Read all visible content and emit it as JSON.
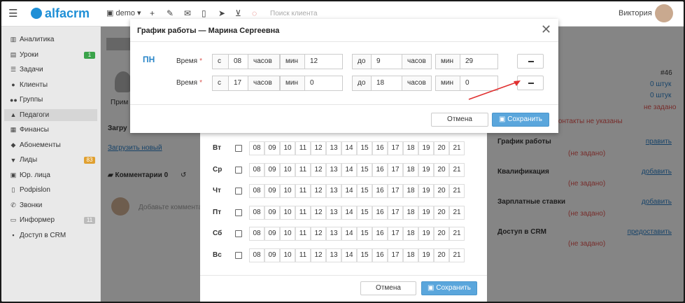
{
  "colors": {
    "brand": "#1e8fd6",
    "accent": "#5aa6dc",
    "danger": "#d9534f",
    "link": "#2a7bbf"
  },
  "topbar": {
    "logo": "alfacrm",
    "branch": "demo",
    "search_placeholder": "Поиск клиента",
    "user": "Виктория"
  },
  "sidebar": {
    "items": [
      {
        "label": "Аналитика",
        "icon": "chart-icon"
      },
      {
        "label": "Уроки",
        "icon": "calendar-icon",
        "badge": "1"
      },
      {
        "label": "Задачи",
        "icon": "tasks-icon"
      },
      {
        "label": "Клиенты",
        "icon": "user-icon"
      },
      {
        "label": "Группы",
        "icon": "users-icon"
      },
      {
        "label": "Педагоги",
        "icon": "graduation-icon"
      },
      {
        "label": "Финансы",
        "icon": "money-icon"
      },
      {
        "label": "Абонементы",
        "icon": "tag-icon"
      },
      {
        "label": "Лиды",
        "icon": "funnel-icon",
        "badge": "83"
      },
      {
        "label": "Юр. лица",
        "icon": "building-icon"
      },
      {
        "label": "Podpislon",
        "icon": "doc-icon"
      },
      {
        "label": "Звонки",
        "icon": "phone-icon"
      },
      {
        "label": "Информер",
        "icon": "informer-icon",
        "badge": "11"
      },
      {
        "label": "Доступ в CRM",
        "icon": "lock-icon"
      }
    ]
  },
  "background": {
    "prim_fragment": "Прим",
    "upload_heading": "Загру",
    "upload_link": "Загрузить новый",
    "comments_heading": "Комментарии 0",
    "comment_placeholder": "Добавьте комментар",
    "id_label": "#46",
    "pcs_1": "0 штук",
    "pcs_2": "0 штук",
    "not_set_1": "не задано",
    "contacts_missing": "Контакты не указаны",
    "sections": [
      {
        "label": "График работы",
        "action": "править",
        "value": "(не задано)"
      },
      {
        "label": "Квалификация",
        "action": "добавить",
        "value": "(не задано)"
      },
      {
        "label": "Зарплатные ставки",
        "action": "добавить",
        "value": "(не задано)"
      },
      {
        "label": "Доступ в CRM",
        "action": "предоставить",
        "value": "(не задано)"
      }
    ]
  },
  "schedule_grid": {
    "days": [
      "Вт",
      "Ср",
      "Чт",
      "Пт",
      "Сб",
      "Вс"
    ],
    "hours": [
      "08",
      "09",
      "10",
      "11",
      "12",
      "13",
      "14",
      "15",
      "16",
      "17",
      "18",
      "19",
      "20",
      "21"
    ],
    "cancel": "Отмена",
    "save": "Сохранить"
  },
  "dialog": {
    "title": "График работы — Марина Сергеевна",
    "day": "ПН",
    "rows": [
      {
        "label": "Время",
        "required": "*",
        "from": "с",
        "from_h": "08",
        "h_unit": "часов",
        "min_label": "мин",
        "from_m": "12",
        "to": "до",
        "to_h": "9",
        "to_m": "29"
      },
      {
        "label": "Время",
        "required": "*",
        "from": "с",
        "from_h": "17",
        "h_unit": "часов",
        "min_label": "мин",
        "from_m": "0",
        "to": "до",
        "to_h": "18",
        "to_m": "0"
      }
    ],
    "cancel": "Отмена",
    "save": "Сохранить"
  }
}
